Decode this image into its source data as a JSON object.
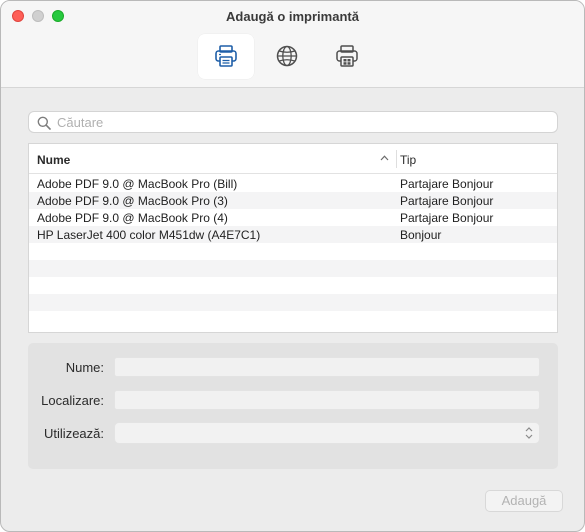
{
  "window": {
    "title": "Adaugă o imprimantă"
  },
  "toolbar": {
    "tabs": [
      {
        "icon": "printer-icon",
        "selected": true
      },
      {
        "icon": "globe-icon",
        "selected": false
      },
      {
        "icon": "windows-printer-icon",
        "selected": false
      }
    ]
  },
  "search": {
    "placeholder": "Căutare",
    "value": ""
  },
  "table": {
    "columns": {
      "name": "Nume",
      "type": "Tip"
    },
    "sort": "ascending",
    "rows": [
      {
        "name": "Adobe PDF 9.0 @ MacBook Pro (Bill)",
        "type": "Partajare Bonjour"
      },
      {
        "name": "Adobe PDF 9.0 @ MacBook Pro (3)",
        "type": "Partajare Bonjour"
      },
      {
        "name": "Adobe PDF 9.0 @ MacBook Pro (4)",
        "type": "Partajare Bonjour"
      },
      {
        "name": "HP LaserJet 400 color M451dw (A4E7C1)",
        "type": "Bonjour"
      }
    ]
  },
  "details": {
    "name_label": "Nume:",
    "location_label": "Localizare:",
    "use_label": "Utilizează:",
    "name_value": "",
    "location_value": "",
    "use_value": ""
  },
  "actions": {
    "add_label": "Adaugă"
  },
  "colors": {
    "close": "#fe5f57",
    "minimize": "#d0d0d0",
    "zoom": "#27c93f",
    "accent": "#1f5fa8"
  }
}
